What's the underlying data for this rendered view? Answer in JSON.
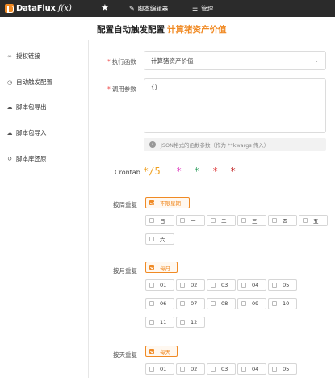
{
  "app": {
    "logo_text": "DataFlux",
    "logo_fx": "f(x)"
  },
  "topnav": {
    "editor_label": "脚本编辑器",
    "manage_label": "管理"
  },
  "page": {
    "title": "配置自动触发配置",
    "subtitle": "计算猪资产价值"
  },
  "sidebar": {
    "items": [
      {
        "label": "授权链接",
        "icon": "link-icon"
      },
      {
        "label": "自动触发配置",
        "icon": "clock-icon"
      },
      {
        "label": "脚本包导出",
        "icon": "cloud-download-icon"
      },
      {
        "label": "脚本包导入",
        "icon": "cloud-upload-icon"
      },
      {
        "label": "脚本库还原",
        "icon": "restore-icon"
      }
    ]
  },
  "form": {
    "func_label": "执行函数",
    "func_value": "计算猪资产价值",
    "args_label": "调用参数",
    "args_value": "{}",
    "args_hint": "JSON格式的函数参数（作为 **kwargs 传入）",
    "crontab_label": "Crontab",
    "crontab_parts": [
      "*/5",
      "*",
      "*",
      "*",
      "*"
    ],
    "crontab_colors": [
      "#f0a020",
      "#e040c0",
      "#30a060",
      "#e04040",
      "#c02020"
    ],
    "weekday_label": "按周重复",
    "weekday_any": "不限星期",
    "weekdays": [
      "日",
      "一",
      "二",
      "三",
      "四",
      "五",
      "六"
    ],
    "month_label": "按月重复",
    "month_any": "每月",
    "months": [
      "01",
      "02",
      "03",
      "04",
      "05",
      "06",
      "07",
      "08",
      "09",
      "10",
      "11",
      "12"
    ],
    "day_label": "按天重复",
    "day_any": "每天",
    "days": [
      "01",
      "02",
      "03",
      "04",
      "05"
    ]
  }
}
